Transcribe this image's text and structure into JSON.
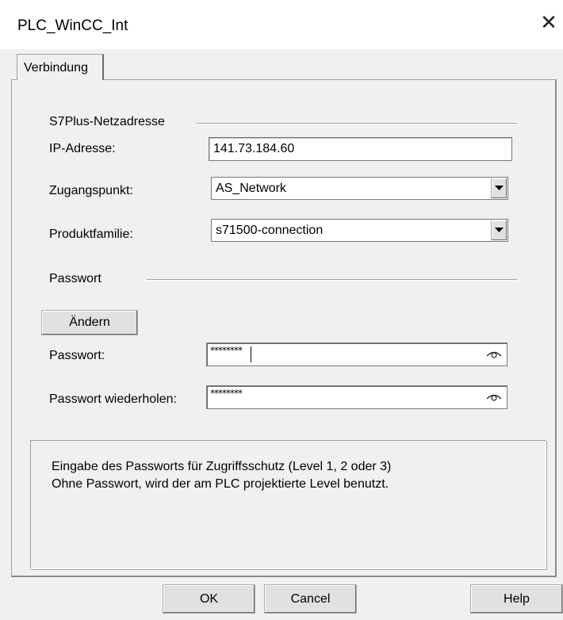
{
  "window": {
    "title": "PLC_WinCC_Int",
    "close_symbol": "✕"
  },
  "tabs": [
    {
      "label": "Verbindung",
      "active": true
    }
  ],
  "network_group": {
    "title": "S7Plus-Netzadresse",
    "ip_label": "IP-Adresse:",
    "ip_value": "141.73.184.60",
    "access_point_label": "Zugangspunkt:",
    "access_point_value": "AS_Network",
    "product_family_label": "Produktfamilie:",
    "product_family_value": "s71500-connection"
  },
  "password_group": {
    "title": "Passwort",
    "change_button": "Ändern",
    "password_label": "Passwort:",
    "password_mask": "********",
    "repeat_label": "Passwort wiederholen:",
    "repeat_mask": "********",
    "reveal_icon": "eye-icon"
  },
  "info": {
    "line1": "Eingabe des Passworts für Zugriffsschutz (Level 1, 2 oder 3)",
    "line2": "Ohne Passwort, wird der am PLC projektierte Level benutzt."
  },
  "buttons": {
    "ok": "OK",
    "cancel": "Cancel",
    "help": "Help"
  },
  "colors": {
    "dialog_bg": "#f0f0f0",
    "titlebar_bg": "#ffffff",
    "button_bg": "#e1e1e1"
  }
}
